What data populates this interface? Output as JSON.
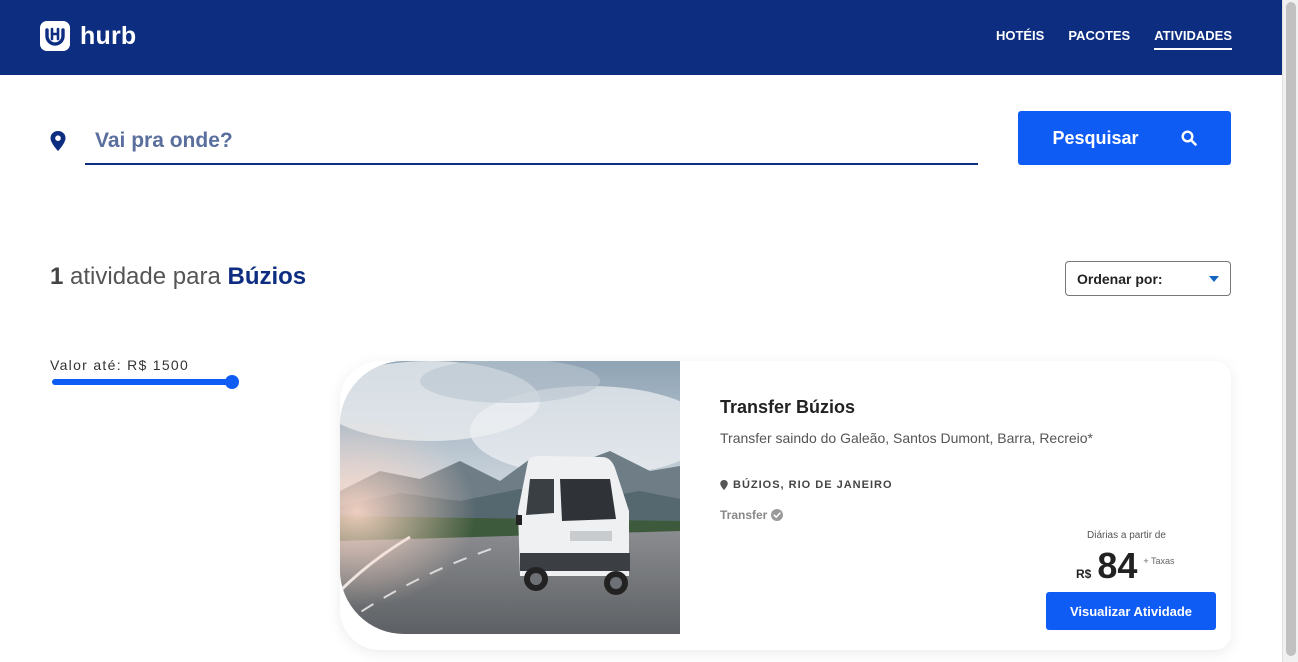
{
  "header": {
    "logo_text": "hurb",
    "nav": [
      {
        "label": "HOTÉIS",
        "active": false
      },
      {
        "label": "PACOTES",
        "active": false
      },
      {
        "label": "ATIVIDADES",
        "active": true
      }
    ]
  },
  "search": {
    "placeholder": "Vai pra onde?",
    "button_label": "Pesquisar"
  },
  "results": {
    "count": "1",
    "text": "atividade para",
    "place": "Búzios",
    "sort_label": "Ordenar por:"
  },
  "filters": {
    "price_label": "Valor até: R$ 1500",
    "price_fill_fraction": 1.0
  },
  "card": {
    "title": "Transfer Búzios",
    "description": "Transfer saindo do Galeão, Santos Dumont, Barra, Recreio*",
    "location": "BÚZIOS, RIO DE JANEIRO",
    "category": "Transfer",
    "price_note": "Diárias a partir de",
    "currency": "R$",
    "price": "84",
    "taxes": "+ Taxas",
    "button_label": "Visualizar Atividade"
  },
  "colors": {
    "header_bg": "#0d2d80",
    "primary": "#0f5cf4"
  },
  "icons": {
    "logo": "hurb-logo-icon",
    "pin": "location-pin-icon",
    "search": "search-icon",
    "sort": "caret-down-icon",
    "verified": "check-circle-icon"
  }
}
